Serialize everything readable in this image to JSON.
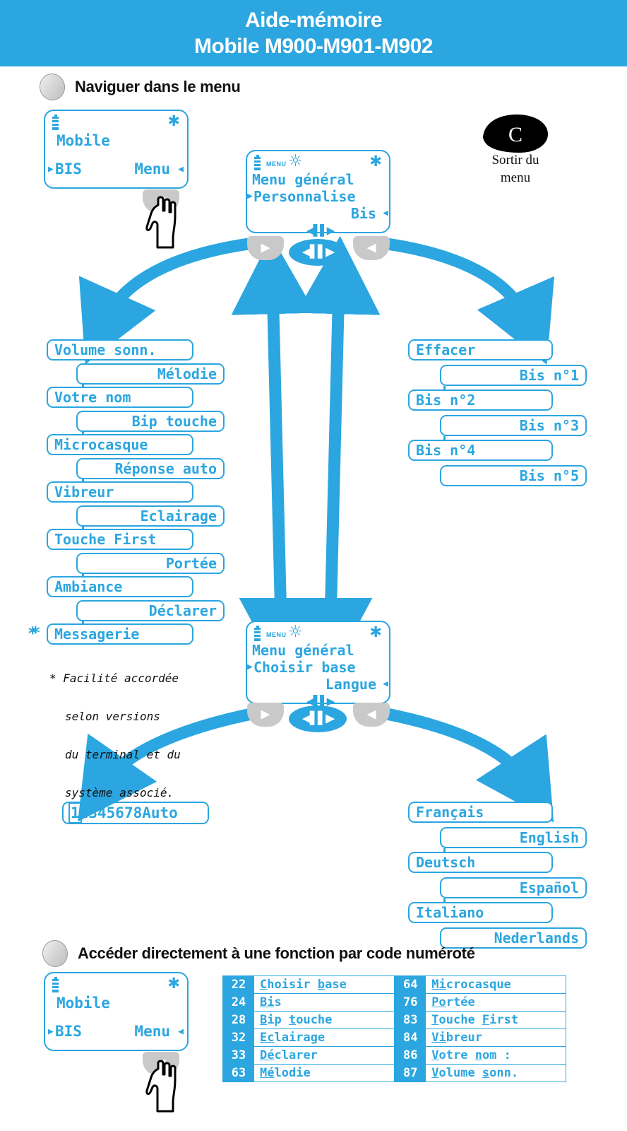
{
  "header": {
    "title_line1": "Aide-mémoire",
    "title_line2": "Mobile M900-M901-M902",
    "bg": "#2ba6e0",
    "fg": "#ffffff"
  },
  "sections": [
    {
      "id": "navigate",
      "title": "Naviguer dans le menu"
    },
    {
      "id": "direct-code",
      "title": "Accéder directement à une fonction par code numéroté"
    }
  ],
  "exit": {
    "key_label": "C",
    "caption_line1": "Sortir du",
    "caption_line2": "menu"
  },
  "screens": {
    "idle_top": {
      "title": "Mobile",
      "softkey_left": "BIS",
      "softkey_right": "Menu",
      "left_marker": "▶",
      "right_marker": "◀",
      "battery_icon": "battery-icon",
      "signal_icon": "asterisk-icon"
    },
    "menu_general_1": {
      "status_label": "MENU",
      "title": "Menu général",
      "item_selected": "Personnalise",
      "item_right": "Bis",
      "left_marker": "▶",
      "right_marker": "◀"
    },
    "menu_general_2": {
      "status_label": "MENU",
      "title": "Menu général",
      "item_selected": "Choisir base",
      "item_right": "Langue",
      "left_marker": "▶",
      "right_marker": "◀"
    },
    "idle_bottom": {
      "title": "Mobile",
      "softkey_left": "BIS",
      "softkey_right": "Menu",
      "left_marker": "▶",
      "right_marker": "◀"
    }
  },
  "personnalise_items": [
    {
      "label": "Volume sonn.",
      "align": "left"
    },
    {
      "label": "Mélodie",
      "align": "right"
    },
    {
      "label": "Votre nom",
      "align": "left"
    },
    {
      "label": "Bip touche",
      "align": "right"
    },
    {
      "label": "Microcasque",
      "align": "left"
    },
    {
      "label": "Réponse auto",
      "align": "right"
    },
    {
      "label": "Vibreur",
      "align": "left"
    },
    {
      "label": "Eclairage",
      "align": "right"
    },
    {
      "label": "Touche First",
      "align": "left"
    },
    {
      "label": "Portée",
      "align": "right"
    },
    {
      "label": "Ambiance",
      "align": "left"
    },
    {
      "label": "Déclarer",
      "align": "right"
    },
    {
      "label": "Messagerie",
      "align": "left",
      "starred": true
    }
  ],
  "footnote": {
    "marker": "*",
    "line1": "Facilité accordée",
    "line2": "selon versions",
    "line3": "du terminal et du",
    "line4": "système associé."
  },
  "bis_items": [
    {
      "label": "Effacer",
      "align": "left"
    },
    {
      "label": "Bis n°1",
      "align": "right"
    },
    {
      "label": "Bis n°2",
      "align": "left"
    },
    {
      "label": "Bis n°3",
      "align": "right"
    },
    {
      "label": "Bis n°4",
      "align": "left"
    },
    {
      "label": "Bis n°5",
      "align": "right"
    }
  ],
  "base_choice": {
    "digits": [
      "1",
      "2",
      "3",
      "4",
      "5",
      "6",
      "7",
      "8"
    ],
    "auto_label": "Auto",
    "selected_digit": "1"
  },
  "langue_items": [
    {
      "label": "Français",
      "align": "left"
    },
    {
      "label": "English",
      "align": "right"
    },
    {
      "label": "Deutsch",
      "align": "left"
    },
    {
      "label": "Español",
      "align": "right"
    },
    {
      "label": "Italiano",
      "align": "left"
    },
    {
      "label": "Nederlands",
      "align": "right"
    }
  ],
  "code_table": {
    "left_column": [
      {
        "code": "22",
        "label": "Choisir base",
        "accel": [
          "C",
          "b"
        ]
      },
      {
        "code": "24",
        "label": "Bis",
        "accel": [
          "B",
          "i"
        ]
      },
      {
        "code": "28",
        "label": "Bip touche",
        "accel": [
          "B",
          "t"
        ]
      },
      {
        "code": "32",
        "label": "Eclairage",
        "accel": [
          "E",
          "c"
        ]
      },
      {
        "code": "33",
        "label": "Déclarer",
        "accel": [
          "D",
          "é"
        ]
      },
      {
        "code": "63",
        "label": "Mélodie",
        "accel": [
          "M",
          "é"
        ]
      }
    ],
    "right_column": [
      {
        "code": "64",
        "label": "Microcasque",
        "accel": [
          "M",
          "i"
        ]
      },
      {
        "code": "76",
        "label": "Portée",
        "accel": [
          "P",
          "o"
        ]
      },
      {
        "code": "83",
        "label": "Touche First",
        "accel": [
          "T",
          "F"
        ]
      },
      {
        "code": "84",
        "label": "Vibreur",
        "accel": [
          "V",
          "i"
        ]
      },
      {
        "code": "86",
        "label": "Votre nom :",
        "accel": [
          "V",
          "n"
        ]
      },
      {
        "code": "87",
        "label": "Volume sonn.",
        "accel": [
          "V",
          "s"
        ]
      }
    ]
  },
  "colors": {
    "accent": "#2ba6e0",
    "key_grey": "#c9c9c9",
    "text_dark": "#111111"
  }
}
